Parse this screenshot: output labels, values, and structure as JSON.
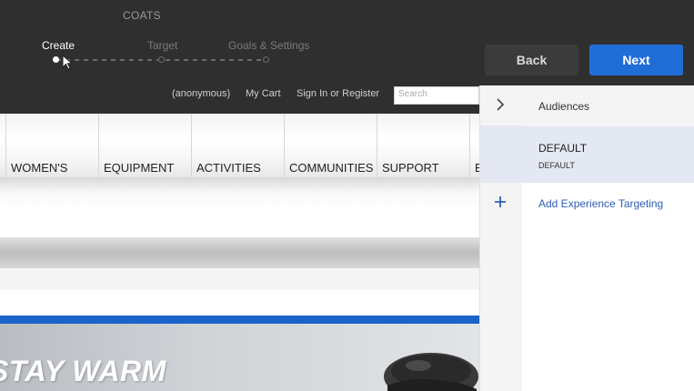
{
  "header": {
    "activity_name": "COATS",
    "steps": [
      {
        "label": "Create",
        "state": "active"
      },
      {
        "label": "Target",
        "state": "inactive"
      },
      {
        "label": "Goals & Settings",
        "state": "inactive"
      }
    ],
    "back_label": "Back",
    "next_label": "Next"
  },
  "preview": {
    "util_links": {
      "anonymous": "(anonymous)",
      "cart": "My Cart",
      "sign_in": "Sign In or Register"
    },
    "search_placeholder": "Search",
    "nav": [
      "WOMEN'S",
      "EQUIPMENT",
      "ACTIVITIES",
      "COMMUNITIES",
      "SUPPORT",
      "E"
    ],
    "hero_text": "STAY WARM"
  },
  "panel": {
    "audiences_label": "Audiences",
    "experience": {
      "title": "DEFAULT",
      "subtitle": "DEFAULT"
    },
    "add_targeting_label": "Add Experience Targeting"
  },
  "colors": {
    "next_button": "#1f6ed8",
    "selected_row": "#e3e8f2",
    "link": "#2d5fb4",
    "hero_accent": "#1a63c9"
  },
  "icons": [
    "chevron-right-icon",
    "plus-icon",
    "mouse-cursor-icon"
  ]
}
